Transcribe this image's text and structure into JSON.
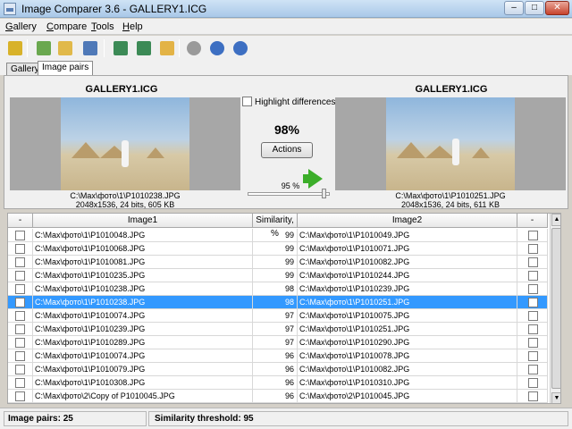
{
  "window": {
    "title": "Image Comparer 3.6 - GALLERY1.ICG",
    "min": "–",
    "max": "□",
    "close": "✕"
  },
  "menu": [
    "Gallery",
    "Compare",
    "Tools",
    "Help"
  ],
  "toolbar": {
    "icons": [
      "wand-icon",
      "new-gallery-icon",
      "open-folder-icon",
      "find-duplicates-icon",
      "compare-icon",
      "check-icon",
      "folder-export-icon",
      "settings-icon",
      "info-icon",
      "help-icon"
    ],
    "colors": [
      "#d8b22a",
      "#6aa84f",
      "#e1b94a",
      "#4f79b8",
      "#3c8a56",
      "#3c8a56",
      "#e3b346",
      "#9a9a9a",
      "#3d6fc2",
      "#3d6fc2"
    ]
  },
  "tabs": [
    "Gallery",
    "Image pairs"
  ],
  "compare": {
    "left": {
      "gallery": "GALLERY1.ICG",
      "path": "C:\\Max\\фото\\1\\P1010238.JPG",
      "info": "2048x1536, 24 bits, 605 KB"
    },
    "right": {
      "gallery": "GALLERY1.ICG",
      "path": "C:\\Max\\фото\\1\\P1010251.JPG",
      "info": "2048x1536, 24 bits, 611 KB"
    },
    "highlight_label": "Highlight differences",
    "similarity": "98%",
    "actions_label": "Actions",
    "threshold_label": "95 %",
    "threshold_value": 0.95
  },
  "table": {
    "columns": [
      "-",
      "Image1",
      "Similarity, %",
      "Image2",
      "-"
    ],
    "rows": [
      {
        "image1": "C:\\Max\\фото\\1\\P1010048.JPG",
        "similarity": "99",
        "image2": "C:\\Max\\фото\\1\\P1010049.JPG",
        "selected": false
      },
      {
        "image1": "C:\\Max\\фото\\1\\P1010068.JPG",
        "similarity": "99",
        "image2": "C:\\Max\\фото\\1\\P1010071.JPG",
        "selected": false
      },
      {
        "image1": "C:\\Max\\фото\\1\\P1010081.JPG",
        "similarity": "99",
        "image2": "C:\\Max\\фото\\1\\P1010082.JPG",
        "selected": false
      },
      {
        "image1": "C:\\Max\\фото\\1\\P1010235.JPG",
        "similarity": "99",
        "image2": "C:\\Max\\фото\\1\\P1010244.JPG",
        "selected": false
      },
      {
        "image1": "C:\\Max\\фото\\1\\P1010238.JPG",
        "similarity": "98",
        "image2": "C:\\Max\\фото\\1\\P1010239.JPG",
        "selected": false
      },
      {
        "image1": "C:\\Max\\фото\\1\\P1010238.JPG",
        "similarity": "98",
        "image2": "C:\\Max\\фото\\1\\P1010251.JPG",
        "selected": true
      },
      {
        "image1": "C:\\Max\\фото\\1\\P1010074.JPG",
        "similarity": "97",
        "image2": "C:\\Max\\фото\\1\\P1010075.JPG",
        "selected": false
      },
      {
        "image1": "C:\\Max\\фото\\1\\P1010239.JPG",
        "similarity": "97",
        "image2": "C:\\Max\\фото\\1\\P1010251.JPG",
        "selected": false
      },
      {
        "image1": "C:\\Max\\фото\\1\\P1010289.JPG",
        "similarity": "97",
        "image2": "C:\\Max\\фото\\1\\P1010290.JPG",
        "selected": false
      },
      {
        "image1": "C:\\Max\\фото\\1\\P1010074.JPG",
        "similarity": "96",
        "image2": "C:\\Max\\фото\\1\\P1010078.JPG",
        "selected": false
      },
      {
        "image1": "C:\\Max\\фото\\1\\P1010079.JPG",
        "similarity": "96",
        "image2": "C:\\Max\\фото\\1\\P1010082.JPG",
        "selected": false
      },
      {
        "image1": "C:\\Max\\фото\\1\\P1010308.JPG",
        "similarity": "96",
        "image2": "C:\\Max\\фото\\1\\P1010310.JPG",
        "selected": false
      },
      {
        "image1": "C:\\Max\\фото\\2\\Copy of P1010045.JPG",
        "similarity": "96",
        "image2": "C:\\Max\\фото\\2\\P1010045.JPG",
        "selected": false
      }
    ]
  },
  "status": {
    "pairs": "Image pairs: 25",
    "threshold": "Similarity threshold: 95"
  }
}
